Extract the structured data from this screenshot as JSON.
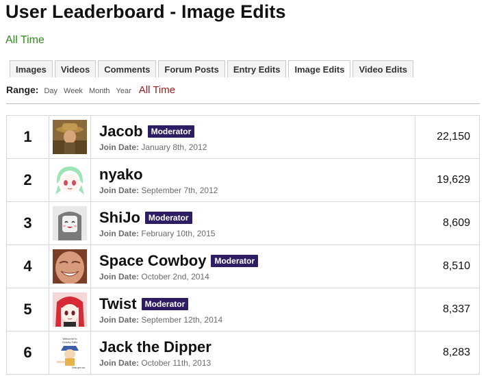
{
  "page": {
    "title": "User Leaderboard - Image Edits",
    "period": "All Time"
  },
  "tabs": [
    {
      "label": "Images",
      "active": false
    },
    {
      "label": "Videos",
      "active": false
    },
    {
      "label": "Comments",
      "active": false
    },
    {
      "label": "Forum Posts",
      "active": false
    },
    {
      "label": "Entry Edits",
      "active": false
    },
    {
      "label": "Image Edits",
      "active": true
    },
    {
      "label": "Video Edits",
      "active": false
    }
  ],
  "range": {
    "label": "Range:",
    "options": [
      "Day",
      "Week",
      "Month",
      "Year",
      "All Time"
    ],
    "selected": "All Time"
  },
  "join_label": "Join Date:",
  "colors": {
    "accent_green": "#2d8a1f",
    "active_range": "#a2161b",
    "badge_bg": "#2e1d63"
  },
  "leaderboard": [
    {
      "rank": "1",
      "name": "Jacob",
      "badge": "Moderator",
      "join_date": "January 8th, 2012",
      "count": "22,150",
      "avatar": "explorer-avatar-icon"
    },
    {
      "rank": "2",
      "name": "nyako",
      "badge": "",
      "join_date": "September 7th, 2012",
      "count": "19,629",
      "avatar": "anime-girl-avatar-icon"
    },
    {
      "rank": "3",
      "name": "ShiJo",
      "badge": "Moderator",
      "join_date": "February 10th, 2015",
      "count": "8,609",
      "avatar": "gray-robot-avatar-icon"
    },
    {
      "rank": "4",
      "name": "Space Cowboy",
      "badge": "Moderator",
      "join_date": "October 2nd, 2014",
      "count": "8,510",
      "avatar": "smiling-face-avatar-icon"
    },
    {
      "rank": "5",
      "name": "Twist",
      "badge": "Moderator",
      "join_date": "September 12th, 2014",
      "count": "8,337",
      "avatar": "red-hair-anime-avatar-icon"
    },
    {
      "rank": "6",
      "name": "Jack the Dipper",
      "badge": "",
      "join_date": "October 11th, 2013",
      "count": "8,283",
      "avatar": "cartoon-kid-avatar-icon",
      "avatar_text": [
        "Welcome to",
        "Gravity Falls",
        "Now get out."
      ]
    }
  ]
}
